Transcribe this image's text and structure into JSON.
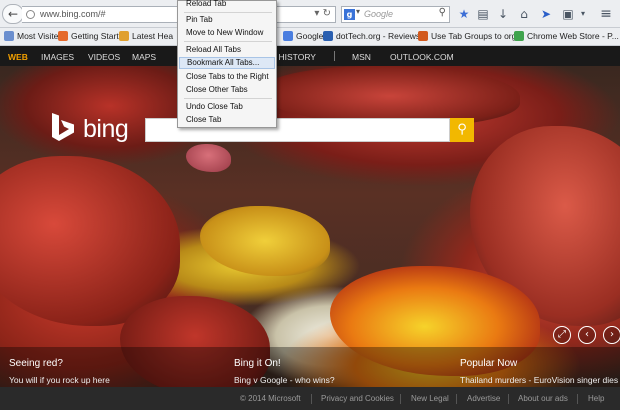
{
  "browser": {
    "url": "www.bing.com/#",
    "search_placeholder": "Google",
    "search_engine_letter": "g",
    "bookmarks": [
      {
        "label": "Most Visited",
        "color": "#6b8fcf"
      },
      {
        "label": "Getting Started",
        "color": "#e5692b"
      },
      {
        "label": "Latest Hea",
        "color": "#e0a030"
      },
      {
        "label": "Google",
        "color": "#4a7ee0"
      },
      {
        "label": "dotTech.org - Reviews...",
        "color": "#2a5fb0"
      },
      {
        "label": "Use Tab Groups to org...",
        "color": "#d25a1e"
      },
      {
        "label": "Chrome Web Store - P...",
        "color": "#3fa34d"
      }
    ]
  },
  "context_menu": {
    "items": [
      "Reload Tab",
      "Pin Tab",
      "Move to New Window",
      "Reload All Tabs",
      "Bookmark All Tabs...",
      "Close Tabs to the Right",
      "Close Other Tabs",
      "Undo Close Tab",
      "Close Tab"
    ],
    "highlighted_index": 4
  },
  "bing": {
    "logo": "bing",
    "nav": [
      "WEB",
      "IMAGES",
      "VIDEOS",
      "MAPS",
      "H HISTORY",
      "MSN",
      "OUTLOOK.COM"
    ],
    "active_nav_color": "#f2a000"
  },
  "info": [
    {
      "title": "Seeing red?",
      "subtitle": "You will if you rock up here"
    },
    {
      "title": "Bing it On!",
      "subtitle": "Bing v Google - who wins?"
    },
    {
      "title": "Popular Now",
      "subtitle": "Thailand murders - EuroVision singer dies"
    }
  ],
  "footer": [
    "© 2014 Microsoft",
    "Privacy and Cookies",
    "New Legal",
    "Advertise",
    "About our ads",
    "Help"
  ],
  "colors": {
    "search_button": "#f2b800",
    "menu_highlight": "#dde8f6"
  }
}
